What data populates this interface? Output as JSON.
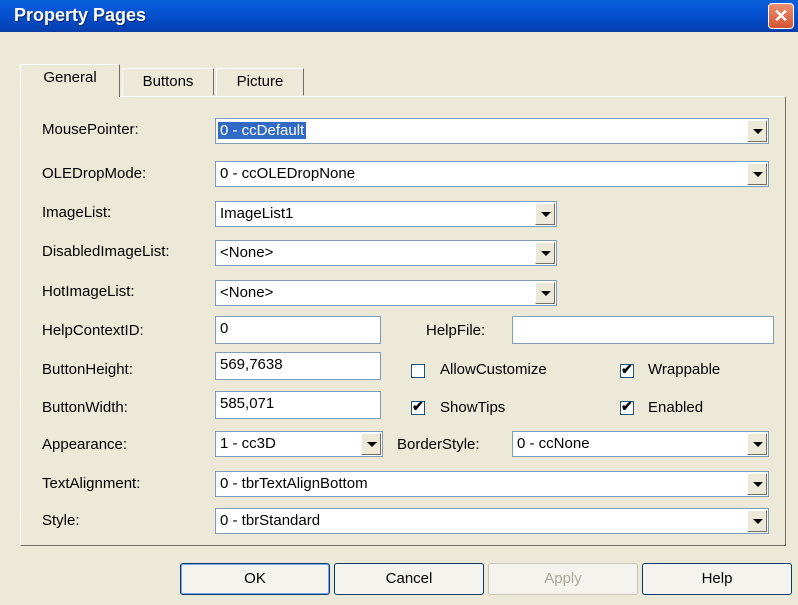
{
  "window": {
    "title": "Property Pages"
  },
  "tabs": [
    {
      "label": "General"
    },
    {
      "label": "Buttons"
    },
    {
      "label": "Picture"
    }
  ],
  "general": {
    "mouse_pointer": {
      "label": "MousePointer:",
      "value": "0 - ccDefault"
    },
    "ole_drop_mode": {
      "label": "OLEDropMode:",
      "value": "0 - ccOLEDropNone"
    },
    "image_list": {
      "label": "ImageList:",
      "value": "ImageList1"
    },
    "disabled_image_list": {
      "label": "DisabledImageList:",
      "value": "<None>"
    },
    "hot_image_list": {
      "label": "HotImageList:",
      "value": "<None>"
    },
    "help_context_id": {
      "label": "HelpContextID:",
      "value": "0"
    },
    "help_file": {
      "label": "HelpFile:",
      "value": ""
    },
    "button_height": {
      "label": "ButtonHeight:",
      "value": "569,7638"
    },
    "button_width": {
      "label": "ButtonWidth:",
      "value": "585,071"
    },
    "appearance": {
      "label": "Appearance:",
      "value": "1 - cc3D"
    },
    "border_style": {
      "label": "BorderStyle:",
      "value": "0 - ccNone"
    },
    "text_alignment": {
      "label": "TextAlignment:",
      "value": "0 - tbrTextAlignBottom"
    },
    "style": {
      "label": "Style:",
      "value": "0 - tbrStandard"
    },
    "allow_customize": {
      "label": "AllowCustomize",
      "checked": false
    },
    "wrappable": {
      "label": "Wrappable",
      "checked": true
    },
    "show_tips": {
      "label": "ShowTips",
      "checked": true
    },
    "enabled": {
      "label": "Enabled",
      "checked": true
    },
    "check_glyph": "✔"
  },
  "buttons": {
    "ok": "OK",
    "cancel": "Cancel",
    "apply": "Apply",
    "help": "Help"
  }
}
